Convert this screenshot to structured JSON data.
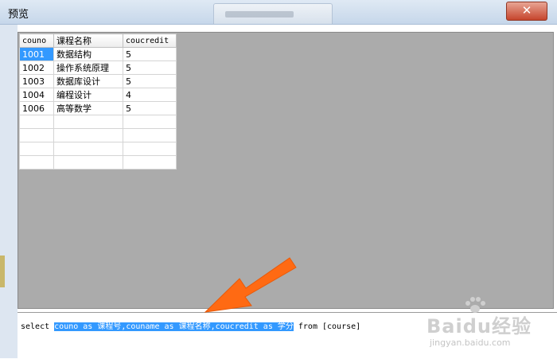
{
  "window": {
    "title": "预览"
  },
  "grid": {
    "columns": [
      "couno",
      "课程名称",
      "coucredit"
    ],
    "rows": [
      [
        "1001",
        "数据结构",
        "5"
      ],
      [
        "1002",
        "操作系统原理",
        "5"
      ],
      [
        "1003",
        "数据库设计",
        "5"
      ],
      [
        "1004",
        "编程设计",
        "4"
      ],
      [
        "1006",
        "高等数学",
        "5"
      ]
    ],
    "empty_rows": 4,
    "selected_row": 0
  },
  "sql": {
    "prefix": "select ",
    "selected": "couno as 课程号,couname as 课程名称,coucredit as 学分",
    "suffix": " from [course]"
  },
  "watermark": {
    "brand": "Baidu经验",
    "url": "jingyan.baidu.com"
  },
  "colors": {
    "selection": "#3399ff",
    "arrow": "#ff6a13",
    "grid_background": "#ababab"
  },
  "icons": {
    "annotation": "arrow-icon",
    "watermark": "paw-icon"
  }
}
